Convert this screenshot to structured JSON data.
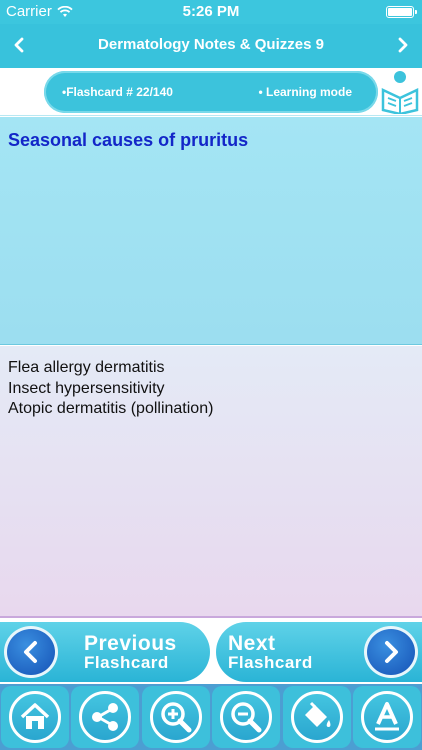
{
  "status_bar": {
    "carrier": "Carrier",
    "time": "5:26 PM"
  },
  "nav": {
    "back_icon": "chevron-left-icon",
    "forward_icon": "chevron-right-icon",
    "title": "Dermatology Notes & Quizzes 9"
  },
  "info": {
    "flashcard": "•Flashcard # 22/140",
    "mode": "• Learning mode"
  },
  "question": "Seasonal causes of pruritus",
  "answer": {
    "lines": [
      "Flea allergy dermatitis",
      "Insect hypersensitivity",
      "Atopic dermatitis (pollination)"
    ]
  },
  "pager": {
    "previous": {
      "line1": "Previous",
      "line2": "Flashcard"
    },
    "next": {
      "line1": "Next",
      "line2": "Flashcard"
    }
  },
  "toolbar": {
    "icons": [
      "home-icon",
      "share-icon",
      "zoom-in-icon",
      "zoom-out-icon",
      "paint-bucket-icon",
      "font-icon"
    ]
  },
  "colors": {
    "accent": "#38c2dc",
    "question_text": "#1326c8",
    "toolbar_bg": "#4c9ed2"
  }
}
